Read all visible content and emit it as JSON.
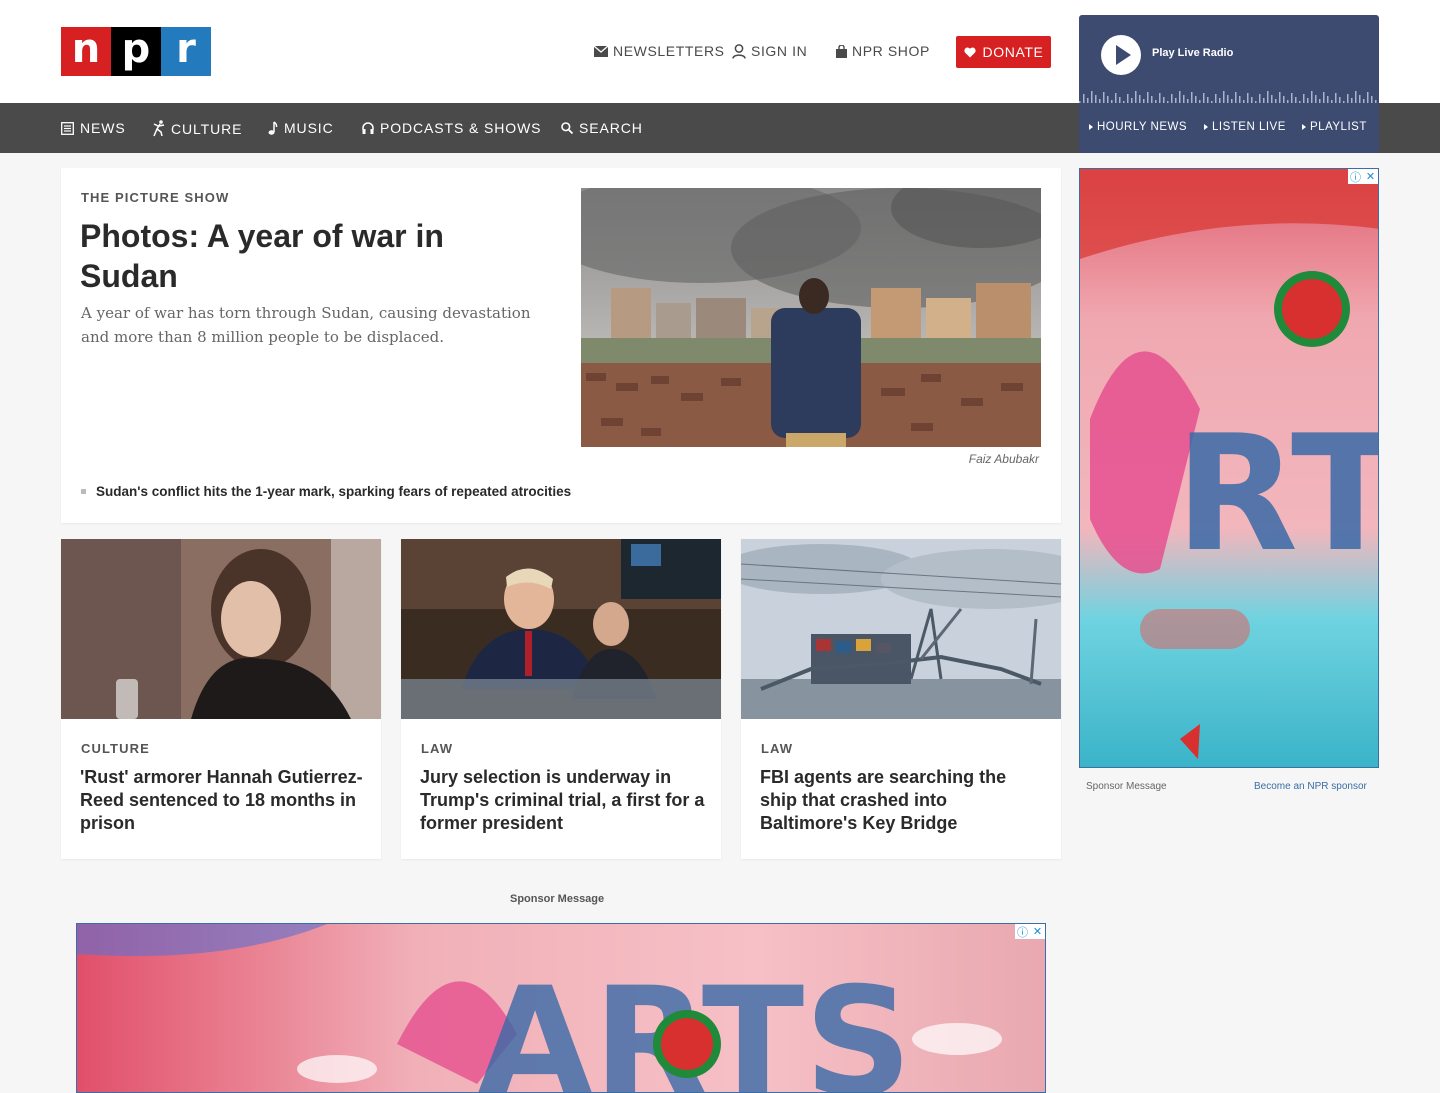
{
  "brand": {
    "logo": [
      "n",
      "p",
      "r"
    ]
  },
  "header": {
    "newsletters": "NEWSLETTERS",
    "sign_in": "SIGN IN",
    "shop": "NPR SHOP",
    "donate": "DONATE"
  },
  "nav": {
    "items": [
      {
        "label": "NEWS",
        "icon": "news-icon"
      },
      {
        "label": "CULTURE",
        "icon": "culture-icon"
      },
      {
        "label": "MUSIC",
        "icon": "music-note-icon"
      },
      {
        "label": "PODCASTS & SHOWS",
        "icon": "headphones-icon"
      },
      {
        "label": "SEARCH",
        "icon": "search-icon"
      }
    ]
  },
  "player": {
    "play_label": "Play Live Radio",
    "links": [
      "HOURLY NEWS",
      "LISTEN LIVE",
      "PLAYLIST"
    ]
  },
  "feature": {
    "slug": "THE PICTURE SHOW",
    "title": "Photos: A year of war in Sudan",
    "teaser": "A year of war has torn through Sudan, causing devastation and more than 8 million people to be displaced.",
    "credit": "Faiz Abubakr",
    "related": "Sudan's conflict hits the 1-year mark, sparking fears of repeated atrocities"
  },
  "stories": [
    {
      "slug": "CULTURE",
      "headline": "'Rust' armorer Hannah Gutierrez-Reed sentenced to 18 months in prison"
    },
    {
      "slug": "LAW",
      "headline": "Jury selection is underway in Trump's criminal trial, a first for a former president"
    },
    {
      "slug": "LAW",
      "headline": "FBI agents are searching the ship that crashed into Baltimore's Key Bridge"
    }
  ],
  "sidebar": {
    "sponsor_label": "Sponsor Message",
    "become_sponsor": "Become an NPR sponsor"
  },
  "sponsor_center": "Sponsor Message",
  "colors": {
    "npr_red": "#d62021",
    "npr_blue": "#237bbd",
    "nav_bg": "#4a4a4a",
    "player_bg": "#3d4b70"
  }
}
